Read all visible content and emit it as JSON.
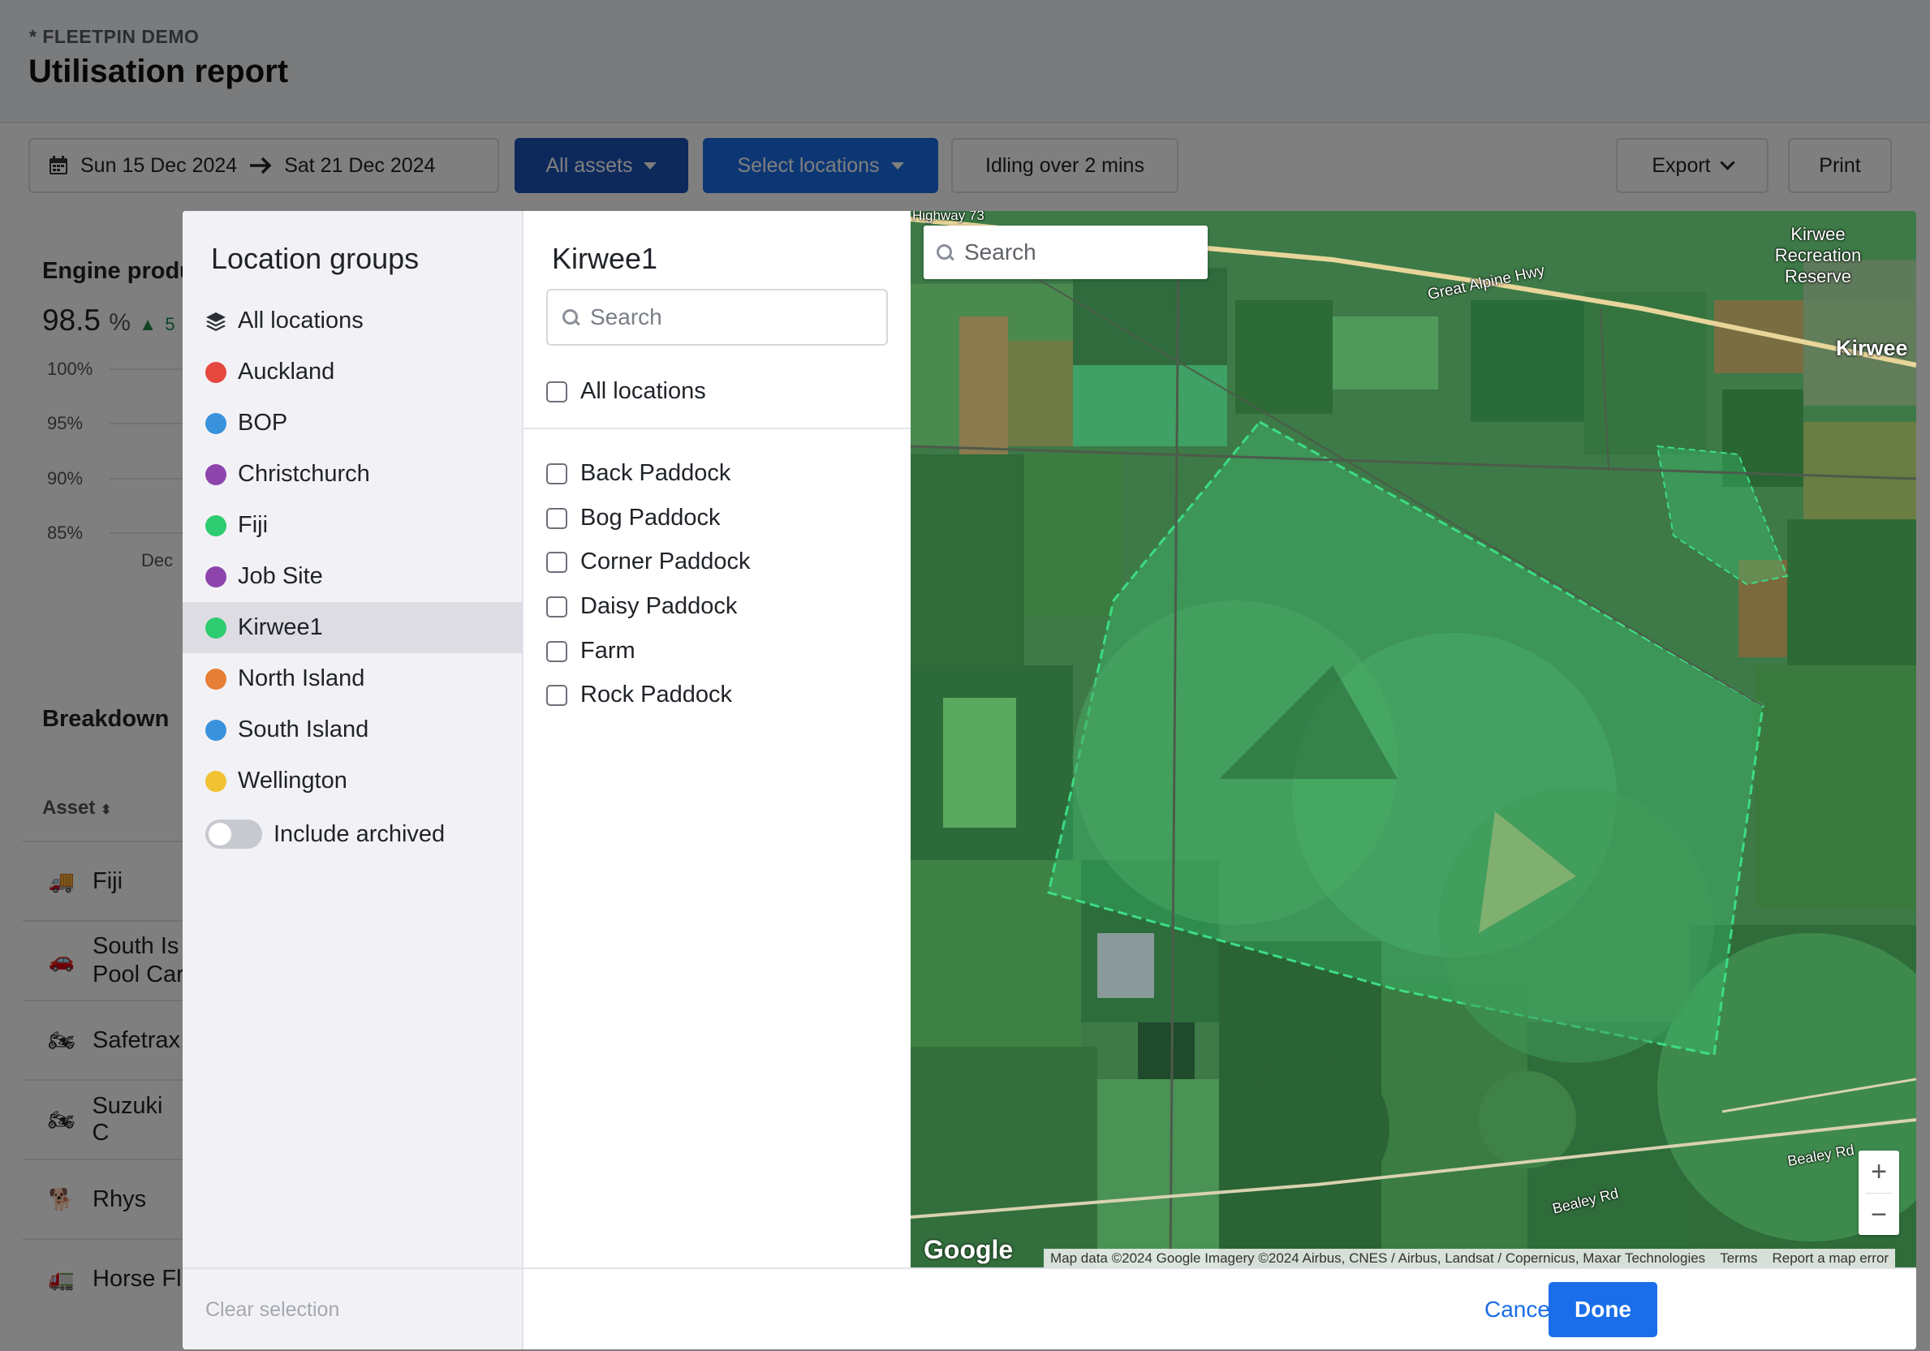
{
  "header": {
    "brand": "* FLEETPIN DEMO",
    "title": "Utilisation report"
  },
  "toolbar": {
    "start_date": "Sun 15 Dec 2024",
    "end_date": "Sat 21 Dec 2024",
    "assets_label": "All assets",
    "locations_label": "Select locations",
    "idling_label": "Idling over 2 mins",
    "export_label": "Export",
    "print_label": "Print"
  },
  "background": {
    "engine_title": "Engine produ",
    "engine_value": "98.5",
    "engine_unit": "%",
    "engine_change": "5",
    "y_ticks": [
      "100%",
      "95%",
      "90%",
      "85%"
    ],
    "x_tick": "Dec",
    "breakdown_title": "Breakdown",
    "asset_header": "Asset",
    "assets": [
      {
        "name": "Fiji",
        "icon": "truck-icon"
      },
      {
        "name": "South Is",
        "name2": "Pool Car",
        "icon": "car-icon"
      },
      {
        "name": "Safetrax",
        "icon": "quad-bike-icon"
      },
      {
        "name": "Suzuki C",
        "icon": "quad-bike-icon"
      },
      {
        "name": "Rhys",
        "icon": "dog-icon"
      },
      {
        "name": "Horse Fl",
        "icon": "horse-float-icon"
      }
    ]
  },
  "groups": {
    "title": "Location groups",
    "items": [
      {
        "label": "All locations",
        "icon": "layers-icon",
        "color": ""
      },
      {
        "label": "Auckland",
        "color": "#e5483f"
      },
      {
        "label": "BOP",
        "color": "#3a92dc"
      },
      {
        "label": "Christchurch",
        "color": "#8e44ad"
      },
      {
        "label": "Fiji",
        "color": "#2ecc71"
      },
      {
        "label": "Job Site",
        "color": "#8e44ad"
      },
      {
        "label": "Kirwee1",
        "color": "#2ecc71",
        "active": true
      },
      {
        "label": "North Island",
        "color": "#e67e35"
      },
      {
        "label": "South Island",
        "color": "#3a92dc"
      },
      {
        "label": "Wellington",
        "color": "#f1c232"
      }
    ],
    "include_archived": "Include archived",
    "clear_selection": "Clear selection"
  },
  "locations": {
    "title": "Kirwee1",
    "search_placeholder": "Search",
    "all_label": "All locations",
    "items": [
      "Back Paddock",
      "Bog Paddock",
      "Corner Paddock",
      "Daisy Paddock",
      "Farm",
      "Rock Paddock"
    ]
  },
  "map": {
    "search_placeholder": "Search",
    "labels": {
      "highway": "Highway 73",
      "great_alpine": "Great Alpine Hwy",
      "reserve_1": "Kirwee",
      "reserve_2": "Recreation",
      "reserve_3": "Reserve",
      "town": "Kirwee",
      "bealey_1": "Bealey Rd",
      "bealey_2": "Bealey Rd"
    },
    "zoom_in": "+",
    "zoom_out": "−",
    "google": "Google",
    "attribution": "Map data ©2024 Google Imagery ©2024 Airbus, CNES / Airbus, Landsat / Copernicus, Maxar Technologies",
    "terms": "Terms",
    "report": "Report a map error"
  },
  "footer": {
    "cancel": "Cancel",
    "done": "Done"
  },
  "colors": {
    "primary": "#1a6ee9",
    "geofence": "#3ddc84"
  }
}
